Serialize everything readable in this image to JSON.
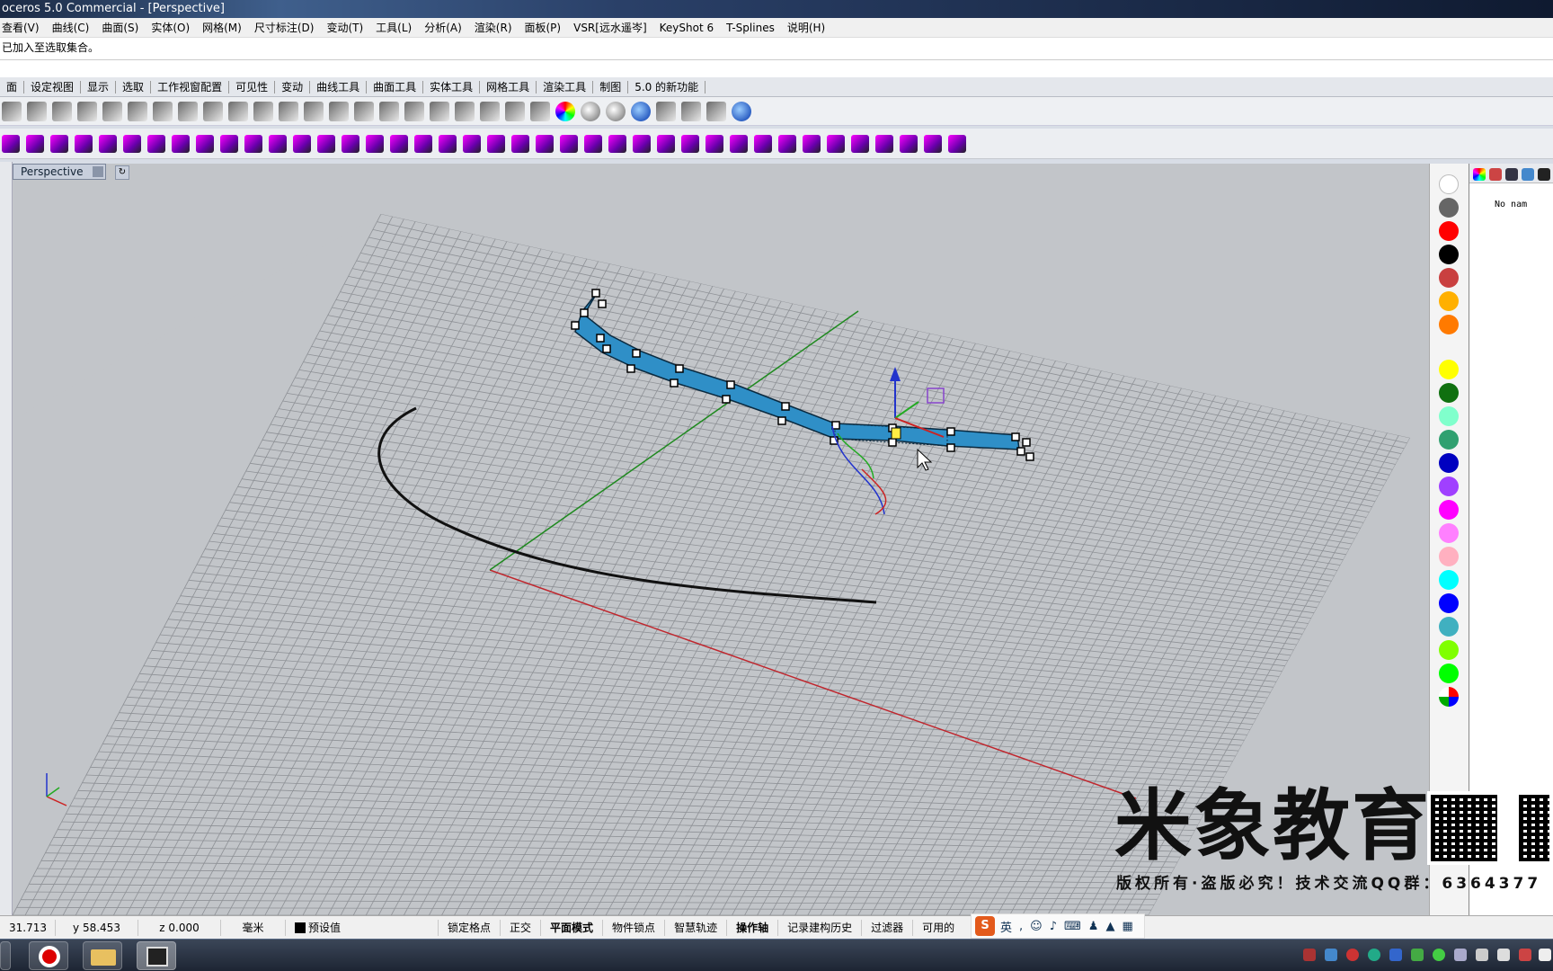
{
  "window": {
    "title": "oceros 5.0 Commercial - [Perspective]"
  },
  "menu": [
    "查看(V)",
    "曲线(C)",
    "曲面(S)",
    "实体(O)",
    "网格(M)",
    "尺寸标注(D)",
    "变动(T)",
    "工具(L)",
    "分析(A)",
    "渲染(R)",
    "面板(P)",
    "VSR[远水遥岑]",
    "KeyShot 6",
    "T-Splines",
    "说明(H)"
  ],
  "command": {
    "history_line": "已加入至选取集合。",
    "prompt": ""
  },
  "toolbar_tabs": [
    "面",
    "设定视图",
    "显示",
    "选取",
    "工作视窗配置",
    "可见性",
    "变动",
    "曲线工具",
    "曲面工具",
    "实体工具",
    "网格工具",
    "渲染工具",
    "制图",
    "5.0 的新功能"
  ],
  "toolbar1_icons": [
    "new-file-icon",
    "save-icon",
    "print-icon",
    "cut-icon",
    "copy-icon",
    "paste-icon",
    "undo-icon",
    "pan-hand-icon",
    "rotate-view-icon",
    "zoom-window-icon",
    "zoom-dynamic-icon",
    "zoom-extents-icon",
    "zoom-selected-icon",
    "undo-view-icon",
    "four-viewports-icon",
    "car-icon",
    "eye-icon",
    "hide-icon",
    "show-icon",
    "light-icon",
    "lock-icon",
    "material-icon",
    "color-wheel-icon",
    "shaded-sphere-icon",
    "rendered-sphere-icon",
    "blue-sphere-icon",
    "pointer-icon",
    "options-gear-icon",
    "snap-icon",
    "help-icon"
  ],
  "viewport": {
    "name": "Perspective"
  },
  "colors": {
    "grid_bg": "#c2c5c9",
    "grid_line": "#8e9196",
    "x_axis": "#c0262d",
    "y_axis": "#1f8a1f",
    "object": "#2f8fc7",
    "palette": [
      "#ffffff",
      "#666666",
      "#ff0000",
      "#000000",
      "#c94040",
      "#ffb000",
      "#ff7a00",
      "#ffffff",
      "#ffff00",
      "#107010",
      "#80ffcc",
      "#30a070",
      "#0000c0",
      "#a040ff",
      "#ff00ff",
      "#ff80ff",
      "#ffb0c0",
      "#00ffff",
      "#0000ff",
      "#40b0c0",
      "#80ff00",
      "#00ff00"
    ]
  },
  "layer_panel": {
    "first_layer": "No nam"
  },
  "watermark": {
    "title": "米象教育",
    "subtitle": "版权所有·盗版必究！技术交流QQ群：6364377"
  },
  "status": {
    "x": "31.713",
    "y": "y 58.453",
    "z": "z 0.000",
    "units": "毫米",
    "layer": "预设值",
    "toggles": [
      "锁定格点",
      "正交",
      "平面模式",
      "物件锁点",
      "智慧轨迹",
      "操作轴",
      "记录建构历史",
      "过滤器"
    ],
    "bold_toggles": [
      2,
      5
    ],
    "trailing": "可用的"
  },
  "ime": {
    "mode": "英"
  }
}
